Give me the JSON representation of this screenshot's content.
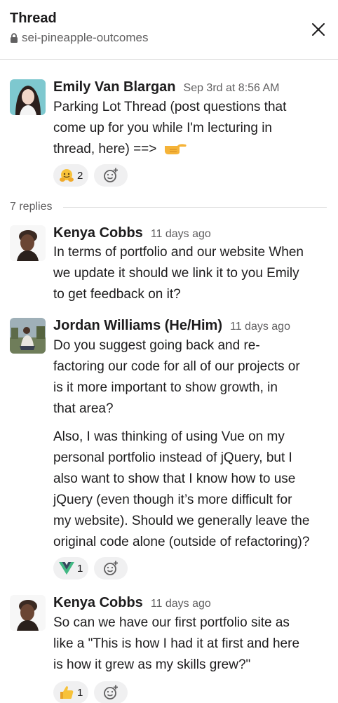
{
  "header": {
    "title": "Thread",
    "channel": "sei-pineapple-outcomes"
  },
  "parent": {
    "author": "Emily Van Blargan",
    "timestamp": "Sep 3rd at 8:56 AM",
    "lines": [
      "Parking Lot Thread (post questions that",
      "come up for you while I'm lecturing in",
      "thread, here) ==>"
    ],
    "reactions": [
      {
        "icon": "hugging-face-icon",
        "count": "2"
      }
    ]
  },
  "replies_label": "7 replies",
  "replies": [
    {
      "author": "Kenya Cobbs",
      "timestamp": "11 days ago",
      "paragraphs": [
        [
          "In terms of portfolio and our website When",
          "we update it should we link it to you Emily",
          "to get feedback on it?"
        ]
      ],
      "reactions": []
    },
    {
      "author": "Jordan Williams (He/Him)",
      "timestamp": "11 days ago",
      "paragraphs": [
        [
          "Do you suggest going back and re-",
          "factoring our code for all of our projects or",
          "is it more important to show growth, in",
          "that area?"
        ],
        [
          "Also, I was thinking of using Vue on my",
          "personal portfolio instead of jQuery, but I",
          "also want to show that I know how to use",
          "jQuery (even though it’s more difficult for",
          "my website). Should we generally leave the",
          "original code alone (outside of refactoring)?"
        ]
      ],
      "reactions": [
        {
          "icon": "vue-logo-icon",
          "count": "1"
        }
      ]
    },
    {
      "author": "Kenya Cobbs",
      "timestamp": "11 days ago",
      "paragraphs": [
        [
          "So can we have our first portfolio site as",
          "like a \"This is how I had it at first and here",
          "is how it grew as my skills grew?\""
        ]
      ],
      "reactions": [
        {
          "icon": "thumbs-up-icon",
          "count": "1"
        }
      ]
    }
  ],
  "colors": {
    "text": "#1d1c1d",
    "muted": "#616061",
    "reaction_bg": "#f0f0f1",
    "divider": "#dddddd",
    "vue_green": "#41b883",
    "vue_dark": "#35495e"
  }
}
